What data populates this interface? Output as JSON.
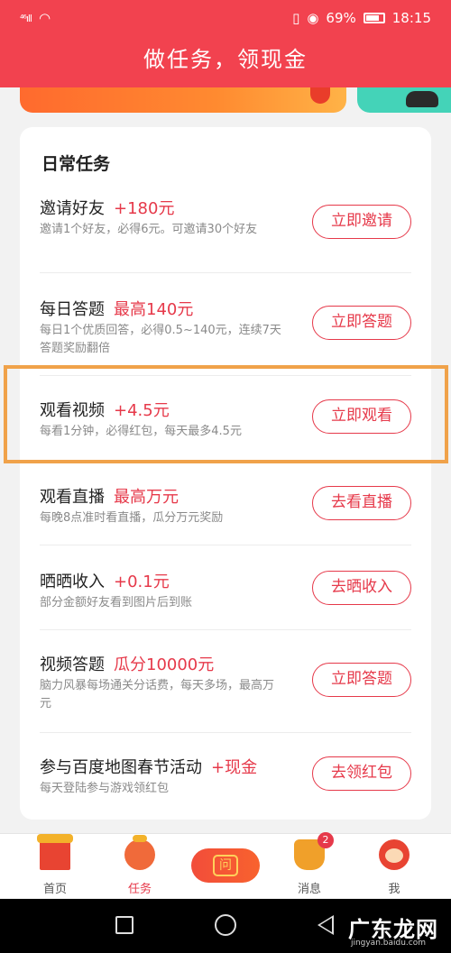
{
  "status_bar": {
    "signal": "⁴⁶ıll",
    "battery": "69%",
    "time": "18:15"
  },
  "header": {
    "title": "做任务，领现金"
  },
  "daily": {
    "title": "日常任务",
    "tasks": [
      {
        "name": "邀请好友",
        "reward": "+180元",
        "desc": "邀请1个好友，必得6元。可邀请30个好友",
        "button": "立即邀请"
      },
      {
        "name": "每日答题",
        "reward": "最高140元",
        "desc": "每日1个优质回答，必得0.5~140元，连续7天答题奖励翻倍",
        "button": "立即答题"
      },
      {
        "name": "观看视频",
        "reward": "+4.5元",
        "desc": "每看1分钟，必得红包，每天最多4.5元",
        "button": "立即观看"
      },
      {
        "name": "观看直播",
        "reward": "最高万元",
        "desc": "每晚8点准时看直播，瓜分万元奖励",
        "button": "去看直播"
      },
      {
        "name": "晒晒收入",
        "reward": "+0.1元",
        "desc": "部分金额好友看到图片后到账",
        "button": "去晒收入"
      },
      {
        "name": "视频答题",
        "reward": "瓜分10000元",
        "desc": "脑力风暴每场通关分话费，每天多场，最高万元",
        "button": "立即答题"
      },
      {
        "name": "参与百度地图春节活动",
        "reward": "+现金",
        "desc": "每天登陆参与游戏领红包",
        "button": "去领红包"
      }
    ]
  },
  "bottom_nav": {
    "items": [
      {
        "label": "首页",
        "icon": "home-icon"
      },
      {
        "label": "任务",
        "icon": "task-icon"
      },
      {
        "label": "消息",
        "icon": "message-icon",
        "badge": "2"
      },
      {
        "label": "我",
        "icon": "profile-icon"
      }
    ],
    "center_icon": "问"
  },
  "watermark": {
    "text": "广东龙网",
    "sub": "jingyan.baidu.com"
  },
  "colors": {
    "accent": "#f2424f",
    "reward": "#e6394a",
    "highlight": "#f0a24a"
  }
}
